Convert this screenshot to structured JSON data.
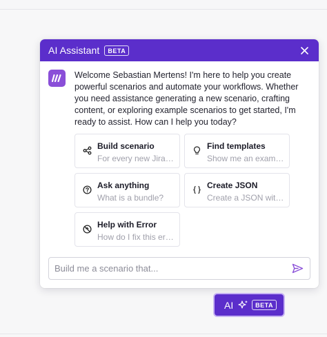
{
  "header": {
    "title": "AI Assistant",
    "badge": "BETA"
  },
  "message": {
    "text": "Welcome Sebastian Mertens! I'm here to help you create powerful scenarios and automate your workflows. Whether you need assistance generating a new scenario, crafting content, or exploring example scenarios to get started, I'm ready to assist. How can I help you today?"
  },
  "cards": [
    {
      "title": "Build scenario",
      "subtitle": "For every new Jira issue",
      "icon": "share-nodes-icon"
    },
    {
      "title": "Find templates",
      "subtitle": "Show me an example",
      "icon": "lightbulb-icon"
    },
    {
      "title": "Ask anything",
      "subtitle": "What is a bundle?",
      "icon": "question-circle-icon"
    },
    {
      "title": "Create JSON",
      "subtitle": "Create a JSON with data",
      "icon": "braces-icon"
    },
    {
      "title": "Help with Error",
      "subtitle": "How do I fix this error?",
      "icon": "error-slash-icon"
    }
  ],
  "input": {
    "placeholder": "Build me a scenario that...",
    "value": ""
  },
  "fab": {
    "label": "AI",
    "badge": "BETA"
  },
  "colors": {
    "accent": "#5b2ecb",
    "avatar": "#8a4fd8",
    "send": "#8a4fd8"
  }
}
